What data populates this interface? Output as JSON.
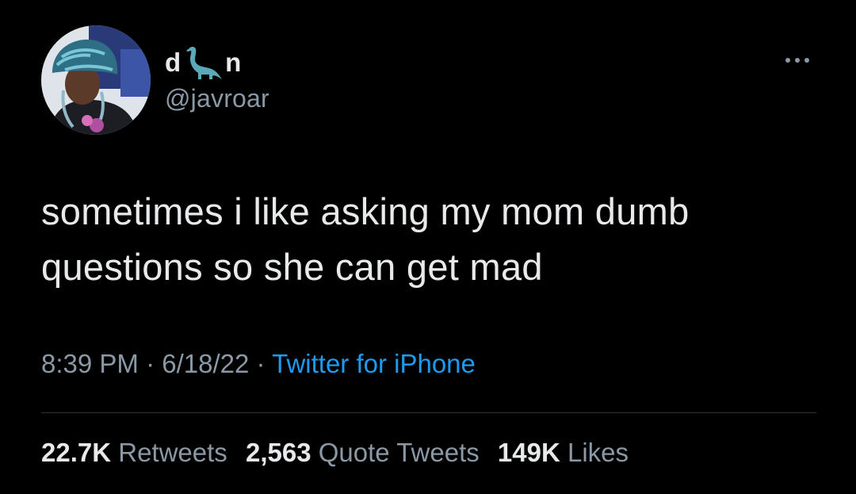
{
  "author": {
    "name_part_1": "d",
    "name_part_2": "n",
    "name_emoji_icon": "dinosaur-icon",
    "handle": "@javroar",
    "avatar_icon": "profile-photo"
  },
  "tweet": {
    "line1": "sometimes i like asking my mom dumb",
    "line2": "questions so she can get mad",
    "time": "8:39 PM",
    "separator": "·",
    "date": "6/18/22",
    "source": "Twitter for iPhone"
  },
  "stats": {
    "retweets_count": "22.7K",
    "retweets_label": "Retweets",
    "quotes_count": "2,563",
    "quotes_label": "Quote Tweets",
    "likes_count": "149K",
    "likes_label": "Likes"
  },
  "colors": {
    "background": "#000000",
    "text_primary": "#e7e9ea",
    "text_secondary": "#8b98a5",
    "link": "#1d9bf0",
    "emoji_teal": "#5aa9b8"
  }
}
